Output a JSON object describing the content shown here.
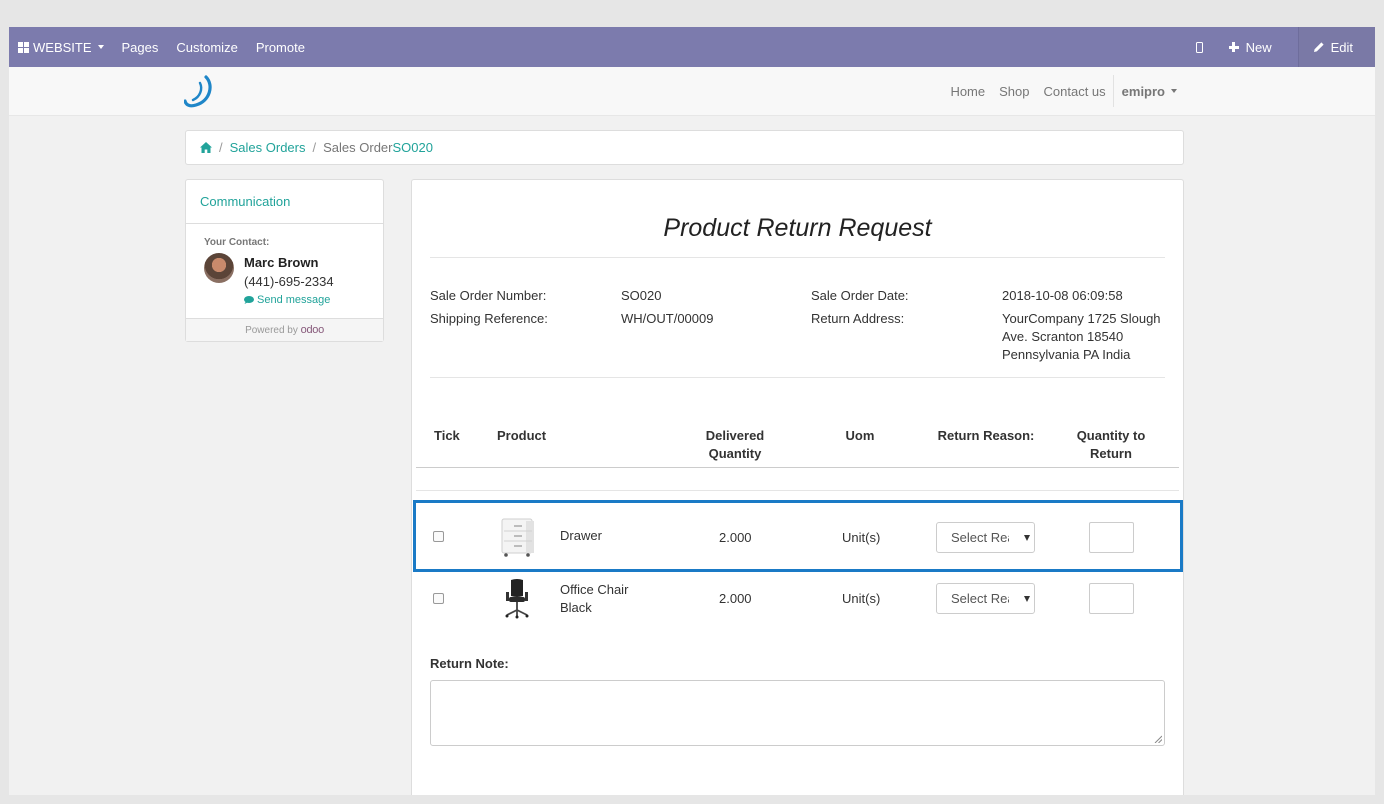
{
  "admin_bar": {
    "website_label": "WEBSITE",
    "pages_label": "Pages",
    "customize_label": "Customize",
    "promote_label": "Promote",
    "new_label": "New",
    "edit_label": "Edit"
  },
  "site_nav": {
    "home": "Home",
    "shop": "Shop",
    "contact": "Contact us",
    "user": "emipro"
  },
  "breadcrumb": {
    "sales_orders": "Sales Orders",
    "current_prefix": "Sales Order",
    "current_ref": "SO020"
  },
  "sidebar": {
    "communication": "Communication",
    "your_contact": "Your Contact:",
    "contact_name": "Marc Brown",
    "contact_phone": "(441)-695-2334",
    "send_message": "Send message",
    "powered_by": "Powered by",
    "odoo": "odoo"
  },
  "form": {
    "title": "Product Return Request",
    "sale_order_number_label": "Sale Order Number:",
    "sale_order_number": "SO020",
    "shipping_reference_label": "Shipping Reference:",
    "shipping_reference": "WH/OUT/00009",
    "sale_order_date_label": "Sale Order Date:",
    "sale_order_date": "2018-10-08 06:09:58",
    "return_address_label": "Return Address:",
    "return_address_line1": "YourCompany 1725 Slough",
    "return_address_line2": "Ave. Scranton 18540",
    "return_address_line3": "Pennsylvania PA India",
    "return_note_label": "Return Note:"
  },
  "table": {
    "headers": {
      "tick": "Tick",
      "product": "Product",
      "delivered_1": "Delivered",
      "delivered_2": "Quantity",
      "uom": "Uom",
      "reason": "Return Reason:",
      "qty_1": "Quantity to",
      "qty_2": "Return"
    },
    "rows": [
      {
        "product_line1": "Drawer",
        "product_line2": "",
        "delivered": "2.000",
        "uom": "Unit(s)",
        "reason_placeholder": "Select Rea",
        "image": "drawer-image"
      },
      {
        "product_line1": "Office Chair",
        "product_line2": "Black",
        "delivered": "2.000",
        "uom": "Unit(s)",
        "reason_placeholder": "Select Rea",
        "image": "office-chair-image"
      }
    ]
  },
  "colors": {
    "admin_bar": "#7c7bad",
    "accent": "#21a39a",
    "highlight_border": "#1a7ac6"
  }
}
